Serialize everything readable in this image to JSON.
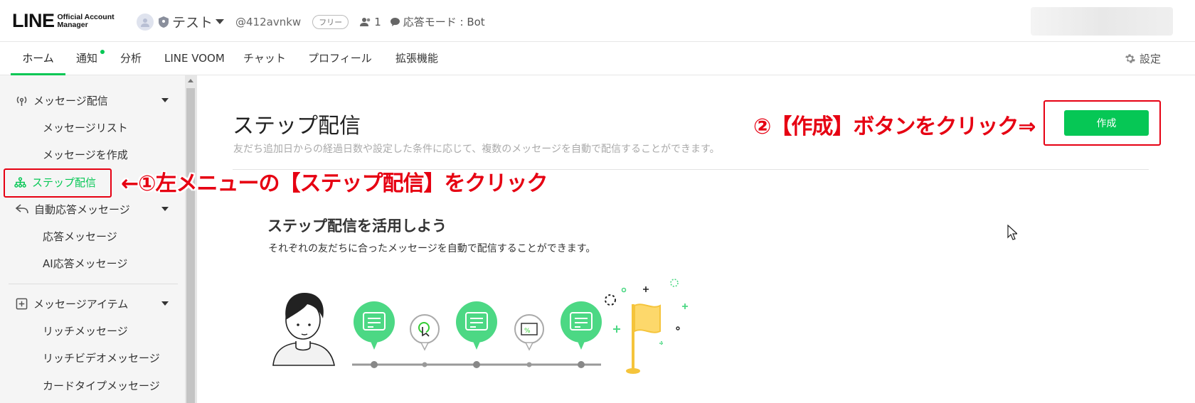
{
  "header": {
    "logo_main": "LINE",
    "logo_sub": "Official Account Manager",
    "account_name": "テスト",
    "account_id": "@412avnkw",
    "plan_badge": "フリー",
    "friend_count": "1",
    "response_mode": "応答モード : Bot"
  },
  "nav": {
    "tabs": [
      {
        "label": "ホーム",
        "active": true
      },
      {
        "label": "通知"
      },
      {
        "label": "分析"
      },
      {
        "label": "LINE VOOM"
      },
      {
        "label": "チャット"
      },
      {
        "label": "プロフィール"
      },
      {
        "label": "拡張機能"
      }
    ],
    "settings_label": "設定"
  },
  "sidebar": {
    "groups": [
      {
        "label": "メッセージ配信",
        "items": [
          "メッセージリスト",
          "メッセージを作成"
        ]
      },
      {
        "label": "ステップ配信",
        "active": true
      },
      {
        "label": "自動応答メッセージ",
        "items": [
          "応答メッセージ",
          "AI応答メッセージ"
        ]
      },
      {
        "label": "メッセージアイテム",
        "items": [
          "リッチメッセージ",
          "リッチビデオメッセージ",
          "カードタイプメッセージ"
        ]
      }
    ]
  },
  "main": {
    "title": "ステップ配信",
    "description": "友だち追加日からの経過日数や設定した条件に応じて、複数のメッセージを自動で配信することができます。",
    "create_button": "作成",
    "section_title": "ステップ配信を活用しよう",
    "section_desc": "それぞれの友だちに合ったメッセージを自動で配信することができます。"
  },
  "annotations": {
    "step1": "←①左メニューの【ステップ配信】をクリック",
    "step2": "②【作成】ボタンをクリック⇒"
  },
  "colors": {
    "accent": "#06c755",
    "annotation": "#e60012"
  }
}
